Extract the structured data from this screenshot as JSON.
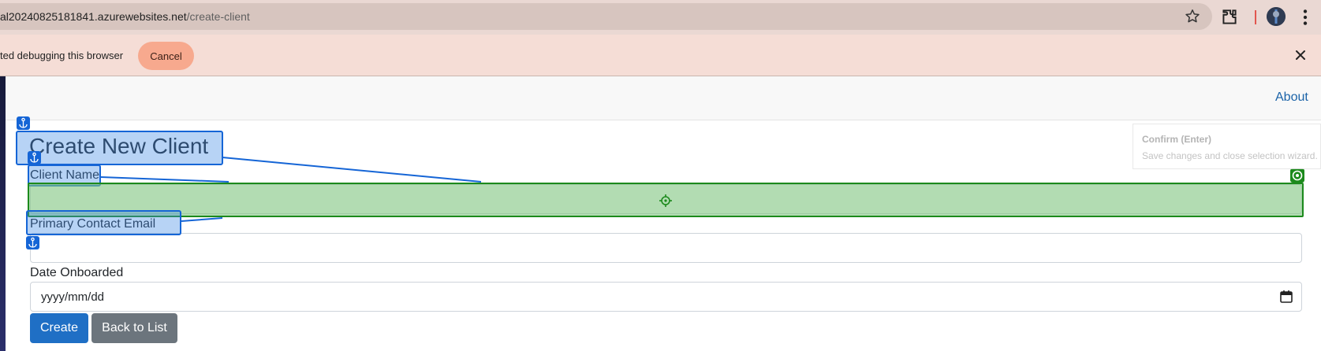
{
  "browser": {
    "url_host": "al20240825181841.azurewebsites.net",
    "url_path": "/create-client"
  },
  "infobar": {
    "message": "ted debugging this browser",
    "cancel_label": "Cancel"
  },
  "navbar": {
    "about_label": "About"
  },
  "form": {
    "title": "Create New Client",
    "client_name_label": "Client Name",
    "client_name_value": "",
    "email_label": "Primary Contact Email",
    "email_value": "",
    "date_label": "Date Onboarded",
    "date_placeholder": "yyyy/mm/dd",
    "create_label": "Create",
    "back_label": "Back to List"
  },
  "wizard": {
    "confirm_title": "Confirm (Enter)",
    "confirm_subtitle": "Save changes and close selection wizard."
  },
  "colors": {
    "primary": "#1f6fc5",
    "secondary": "#6c757d",
    "selection_blue": "#1565d6",
    "selection_green": "#1c8a1c",
    "infobar_bg": "#f5ddd6",
    "cancel_bg": "#f7a98e"
  }
}
